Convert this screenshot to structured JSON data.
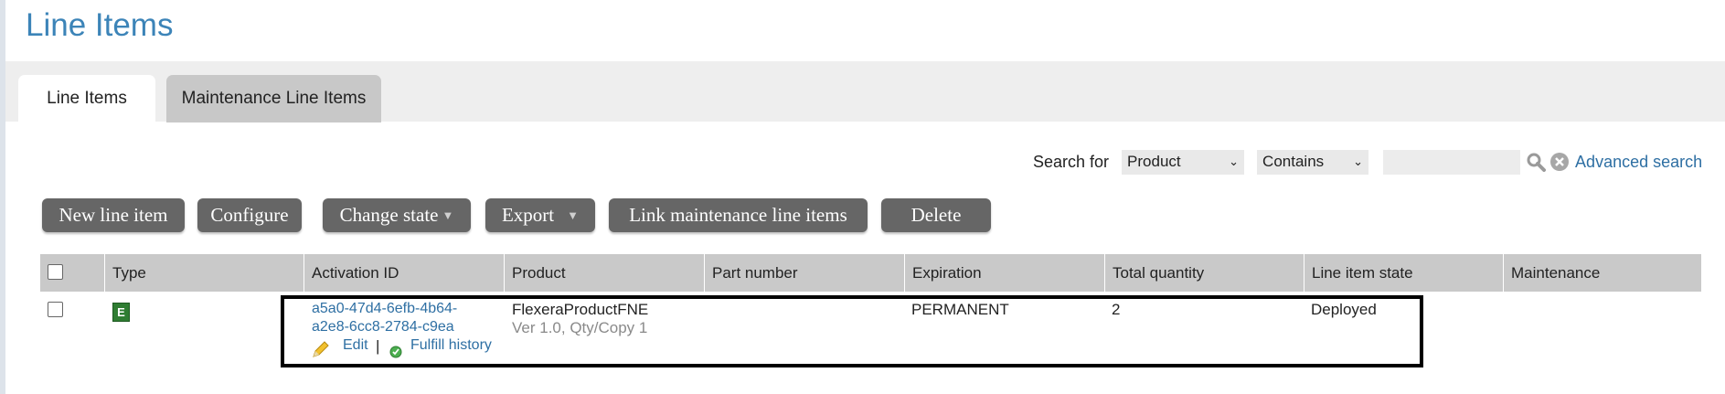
{
  "page": {
    "title": "Line Items"
  },
  "tabs": [
    {
      "label": "Line Items",
      "active": true
    },
    {
      "label": "Maintenance Line Items",
      "active": false
    }
  ],
  "search": {
    "label": "Search for",
    "field_selected": "Product",
    "operator_selected": "Contains",
    "query": "",
    "advanced_label": "Advanced search"
  },
  "toolbar": {
    "new_line_item": "New line item",
    "configure": "Configure",
    "change_state": "Change state",
    "export": "Export",
    "link_maintenance": "Link maintenance line items",
    "delete": "Delete"
  },
  "table": {
    "columns": [
      "Type",
      "Activation ID",
      "Product",
      "Part number",
      "Expiration",
      "Total quantity",
      "Line item state",
      "Maintenance"
    ],
    "rows": [
      {
        "type_badge": "E",
        "activation_id_line1": "a5a0-47d4-6efb-4b64-",
        "activation_id_line2": "a2e8-6cc8-2784-c9ea",
        "edit_label": "Edit",
        "separator": "|",
        "fulfill_label": "Fulfill history",
        "product_name": "FlexeraProductFNE",
        "product_detail": "Ver 1.0, Qty/Copy 1",
        "part_number": "",
        "expiration": "PERMANENT",
        "total_quantity": "2",
        "state": "Deployed",
        "maintenance": ""
      }
    ]
  },
  "colors": {
    "accent_link": "#2e6fa3",
    "title": "#3c84b8",
    "button_bg": "#666666",
    "type_badge": "#2f7d32"
  }
}
